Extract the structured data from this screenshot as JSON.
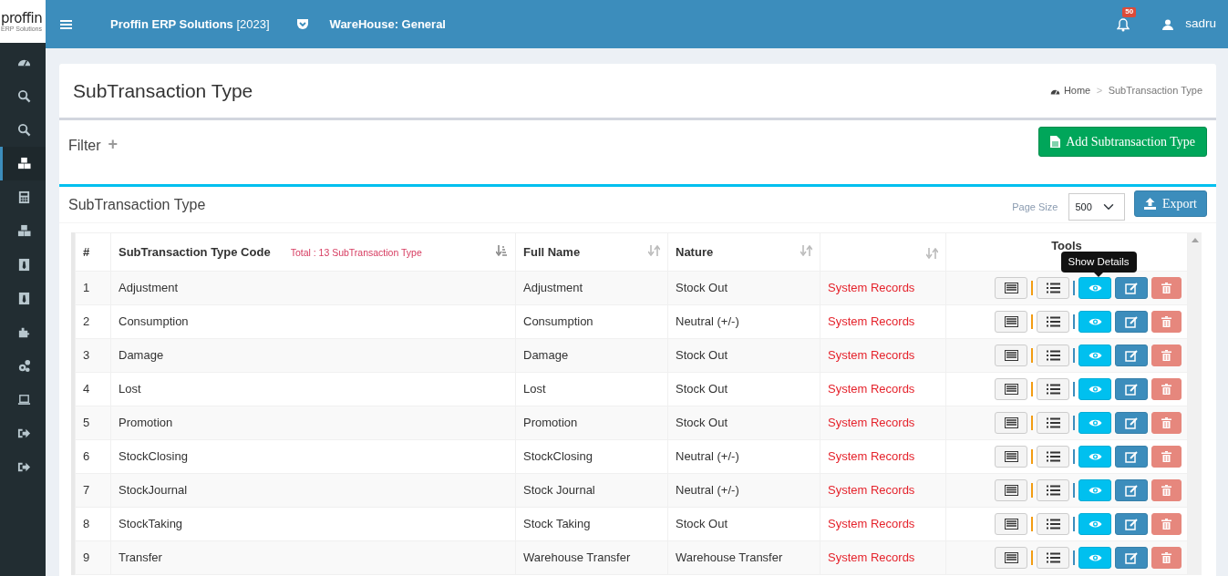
{
  "brand": {
    "logo": "proffin",
    "tagline": "ERP Solutions"
  },
  "topbar": {
    "app_name": "Proffin ERP Solutions",
    "year": "[2023]",
    "warehouse": "WareHouse: General",
    "notifications": "50",
    "user": "sadru"
  },
  "sidebar": {
    "items": [
      {
        "selected": false
      },
      {
        "selected": false
      },
      {
        "selected": false
      },
      {
        "selected": true
      },
      {
        "selected": false
      },
      {
        "selected": false
      },
      {
        "selected": false
      },
      {
        "selected": false
      },
      {
        "selected": false
      },
      {
        "selected": false
      },
      {
        "selected": false
      },
      {
        "selected": false
      },
      {
        "selected": false
      }
    ]
  },
  "page": {
    "title": "SubTransaction Type",
    "breadcrumb": [
      "Home",
      "SubTransaction Type"
    ],
    "breadcrumb_separator": ">"
  },
  "filter": {
    "label": "Filter",
    "toggle": "+",
    "add_button": "Add Subtransaction Type"
  },
  "list": {
    "title": "SubTransaction Type",
    "page_size_label": "Page Size",
    "page_size": "500",
    "export_button": "Export"
  },
  "table": {
    "columns": [
      "#",
      "SubTransaction Type Code",
      "Full Name",
      "Nature",
      "",
      "Tools"
    ],
    "total": "Total : 13 SubTransaction Type",
    "tooltip": "Show Details",
    "rows": [
      {
        "no": "1",
        "code": "Adjustment",
        "full_name": "Adjustment",
        "nature": "Stock Out",
        "remark": "System Records"
      },
      {
        "no": "2",
        "code": "Consumption",
        "full_name": "Consumption",
        "nature": "Neutral (+/-)",
        "remark": "System Records"
      },
      {
        "no": "3",
        "code": "Damage",
        "full_name": "Damage",
        "nature": "Stock Out",
        "remark": "System Records"
      },
      {
        "no": "4",
        "code": "Lost",
        "full_name": "Lost",
        "nature": "Stock Out",
        "remark": "System Records"
      },
      {
        "no": "5",
        "code": "Promotion",
        "full_name": "Promotion",
        "nature": "Stock Out",
        "remark": "System Records"
      },
      {
        "no": "6",
        "code": "StockClosing",
        "full_name": "StockClosing",
        "nature": "Neutral (+/-)",
        "remark": "System Records"
      },
      {
        "no": "7",
        "code": "StockJournal",
        "full_name": "Stock Journal",
        "nature": "Neutral (+/-)",
        "remark": "System Records"
      },
      {
        "no": "8",
        "code": "StockTaking",
        "full_name": "Stock Taking",
        "nature": "Stock Out",
        "remark": "System Records"
      },
      {
        "no": "9",
        "code": "Transfer",
        "full_name": "Warehouse Transfer",
        "nature": "Warehouse Transfer",
        "remark": "System Records"
      }
    ]
  }
}
